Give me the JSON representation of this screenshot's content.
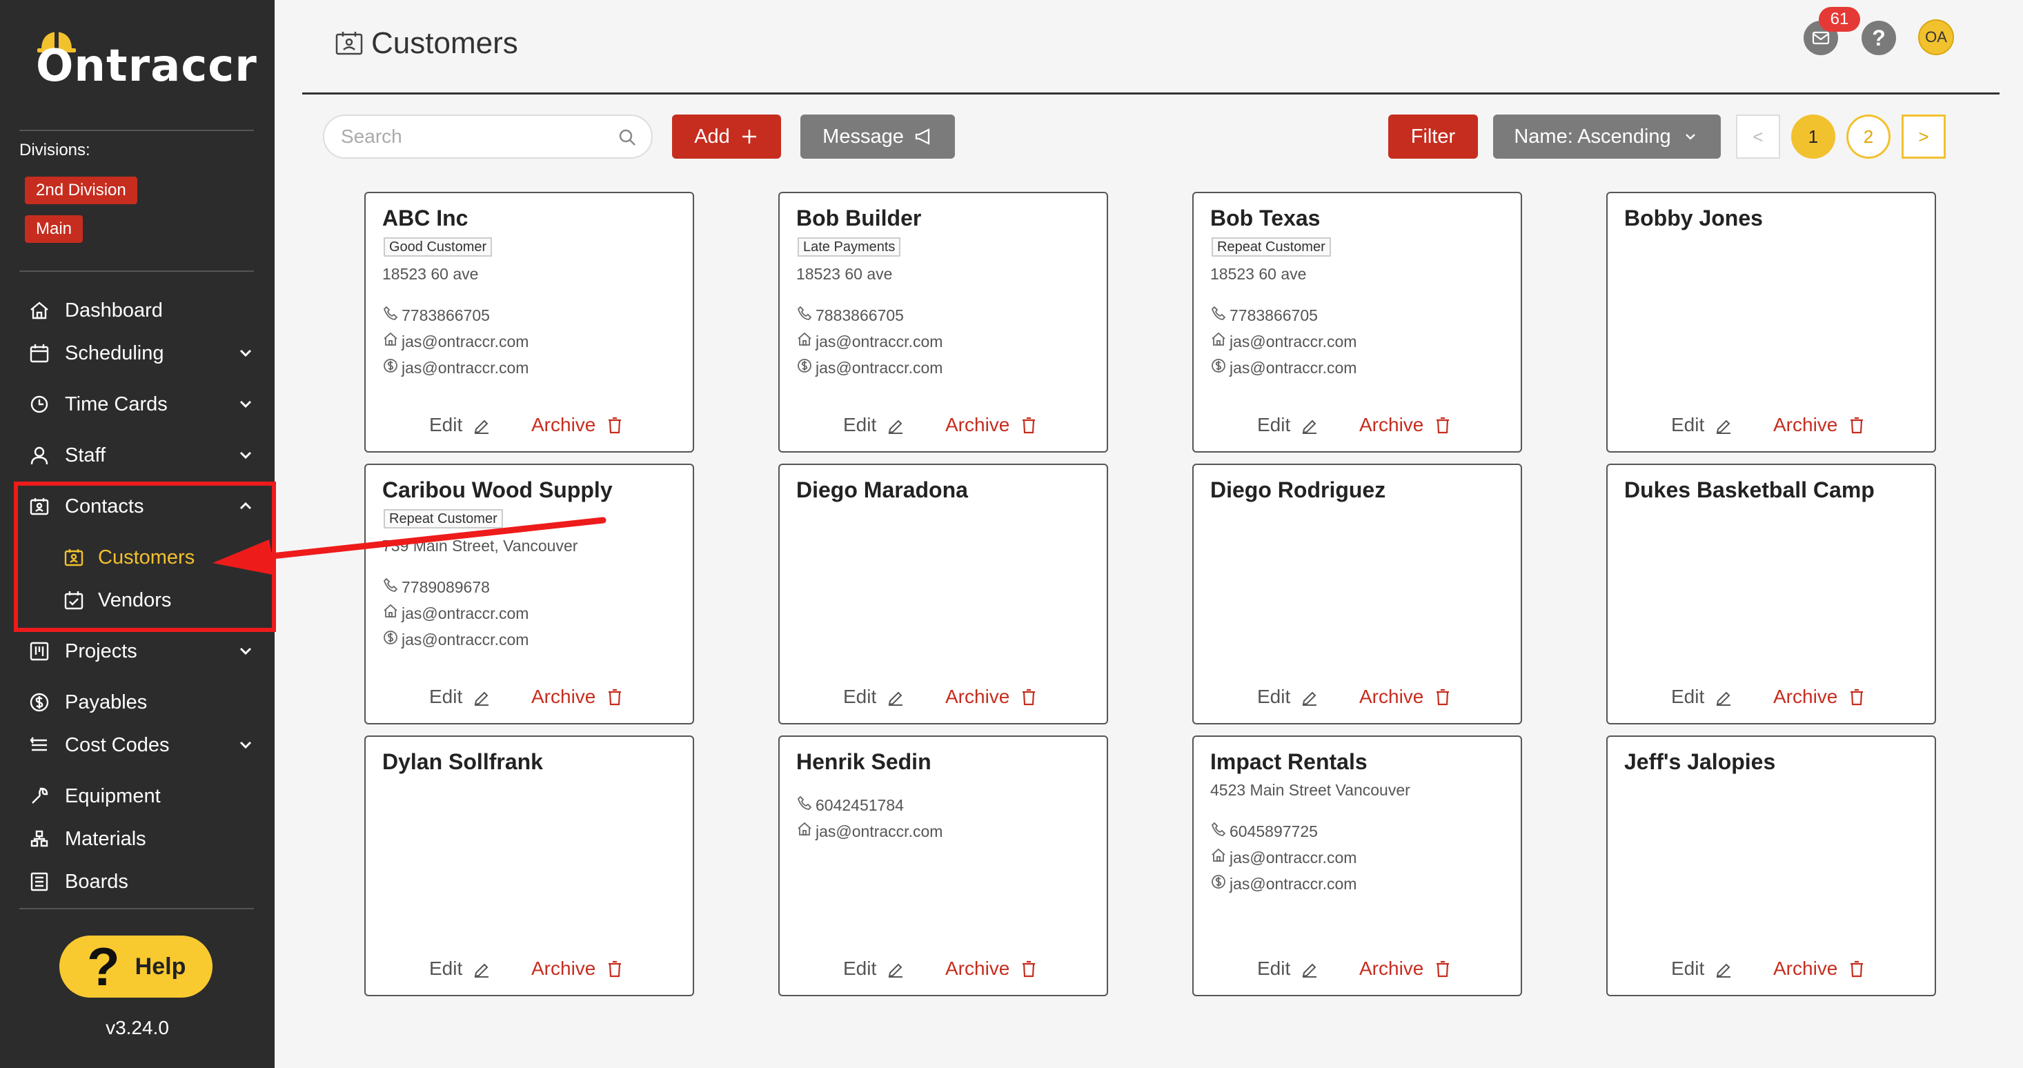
{
  "app": {
    "logo_text": "Ontraccr",
    "version": "v3.24.0",
    "help_label": "Help"
  },
  "sidebar": {
    "divisions_label": "Divisions:",
    "divisions": [
      "2nd Division",
      "Main"
    ],
    "items": [
      {
        "label": "Dashboard",
        "icon": "home-icon",
        "has_chevron": false
      },
      {
        "label": "Scheduling",
        "icon": "calendar-icon",
        "has_chevron": true
      },
      {
        "label": "Time Cards",
        "icon": "clock-icon",
        "has_chevron": true
      },
      {
        "label": "Staff",
        "icon": "user-icon",
        "has_chevron": true
      },
      {
        "label": "Contacts",
        "icon": "contact-card-icon",
        "has_chevron": true,
        "expanded": true
      },
      {
        "label": "Projects",
        "icon": "board-icon",
        "has_chevron": true
      },
      {
        "label": "Payables",
        "icon": "dollar-icon",
        "has_chevron": false
      },
      {
        "label": "Cost Codes",
        "icon": "list-icon",
        "has_chevron": true
      },
      {
        "label": "Equipment",
        "icon": "wrench-icon",
        "has_chevron": false
      },
      {
        "label": "Materials",
        "icon": "materials-icon",
        "has_chevron": false
      },
      {
        "label": "Boards",
        "icon": "boards-icon",
        "has_chevron": false
      }
    ],
    "contacts_sub": [
      {
        "label": "Customers",
        "icon": "contact-card-icon",
        "active": true
      },
      {
        "label": "Vendors",
        "icon": "calendar-check-icon",
        "active": false
      }
    ]
  },
  "header": {
    "title": "Customers",
    "notifications_count": "61",
    "avatar_initials": "OA"
  },
  "toolbar": {
    "search_placeholder": "Search",
    "add_label": "Add",
    "message_label": "Message",
    "filter_label": "Filter",
    "sort_label": "Name: Ascending",
    "pages": [
      "1",
      "2"
    ],
    "current_page": "1",
    "prev_symbol": "<",
    "next_symbol": ">"
  },
  "card_actions": {
    "edit_label": "Edit",
    "archive_label": "Archive"
  },
  "customers": [
    {
      "name": "ABC Inc",
      "tag": "Good Customer",
      "address": "18523 60 ave",
      "phone": "7783866705",
      "email": "jas@ontraccr.com",
      "billing_email": "jas@ontraccr.com"
    },
    {
      "name": "Bob Builder",
      "tag": "Late Payments",
      "address": "18523 60 ave",
      "phone": "7883866705",
      "email": "jas@ontraccr.com",
      "billing_email": "jas@ontraccr.com"
    },
    {
      "name": "Bob Texas",
      "tag": "Repeat Customer",
      "address": "18523 60 ave",
      "phone": "7783866705",
      "email": "jas@ontraccr.com",
      "billing_email": "jas@ontraccr.com"
    },
    {
      "name": "Bobby Jones"
    },
    {
      "name": "Caribou Wood Supply",
      "tag": "Repeat Customer",
      "address": "739 Main Street, Vancouver",
      "phone": "7789089678",
      "email": "jas@ontraccr.com",
      "billing_email": "jas@ontraccr.com"
    },
    {
      "name": "Diego Maradona"
    },
    {
      "name": "Diego Rodriguez"
    },
    {
      "name": "Dukes Basketball Camp"
    },
    {
      "name": "Dylan Sollfrank"
    },
    {
      "name": "Henrik Sedin",
      "phone": "6042451784",
      "email": "jas@ontraccr.com"
    },
    {
      "name": "Impact Rentals",
      "address": "4523 Main Street Vancouver",
      "phone": "6045897725",
      "email": "jas@ontraccr.com",
      "billing_email": "jas@ontraccr.com"
    },
    {
      "name": "Jeff's Jalopies"
    }
  ],
  "colors": {
    "sidebar_bg": "#2c2c2c",
    "accent_red": "#c62d1f",
    "accent_yellow": "#f2c12e",
    "annotation_red": "#ee1b1b"
  }
}
